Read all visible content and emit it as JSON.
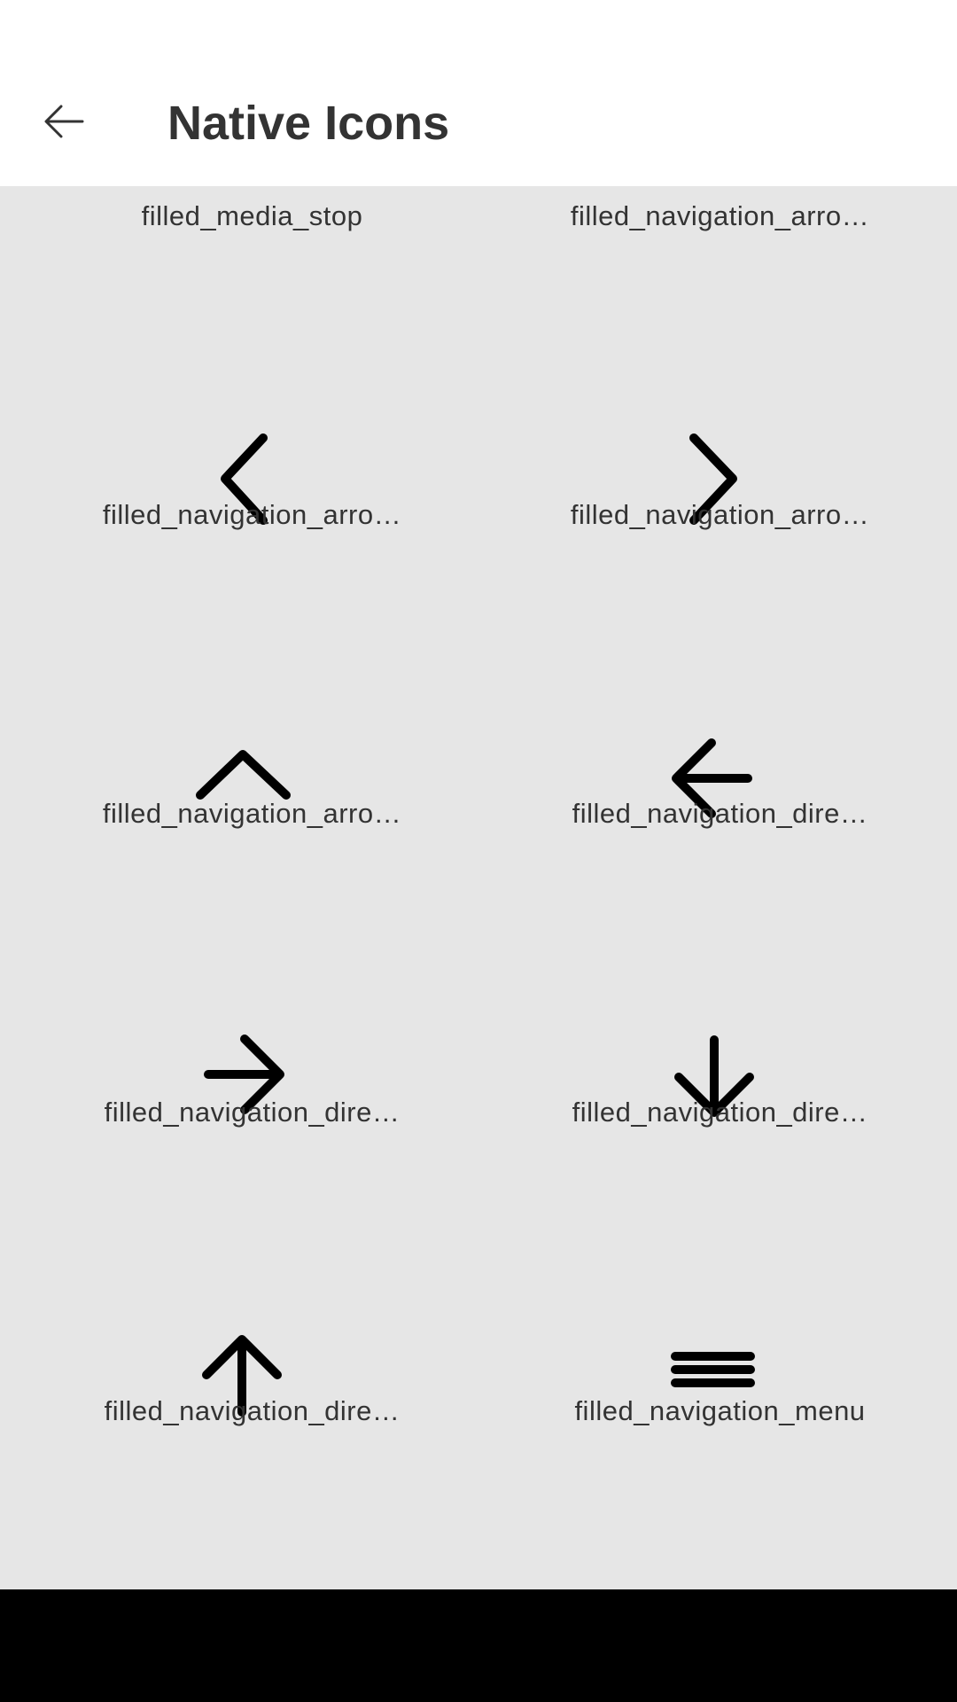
{
  "header": {
    "title": "Native Icons",
    "back_icon": "arrow-left-icon"
  },
  "icons": [
    {
      "label": "filled_media_stop",
      "icon": "stop-icon"
    },
    {
      "label": "filled_navigation_arro…",
      "icon": "arrow-drop-down-icon"
    },
    {
      "label": "filled_navigation_arro…",
      "icon": "chevron-left-icon"
    },
    {
      "label": "filled_navigation_arro…",
      "icon": "chevron-right-icon"
    },
    {
      "label": "filled_navigation_arro…",
      "icon": "chevron-up-icon"
    },
    {
      "label": "filled_navigation_dire…",
      "icon": "arrow-left-icon"
    },
    {
      "label": "filled_navigation_dire…",
      "icon": "arrow-right-icon"
    },
    {
      "label": "filled_navigation_dire…",
      "icon": "arrow-down-icon"
    },
    {
      "label": "filled_navigation_dire…",
      "icon": "arrow-up-icon"
    },
    {
      "label": "filled_navigation_menu",
      "icon": "menu-icon"
    }
  ],
  "colors": {
    "header_bg": "#ffffff",
    "content_bg": "#e6e6e6",
    "text": "#333333",
    "icon": "#000000",
    "navbar_bg": "#000000"
  }
}
